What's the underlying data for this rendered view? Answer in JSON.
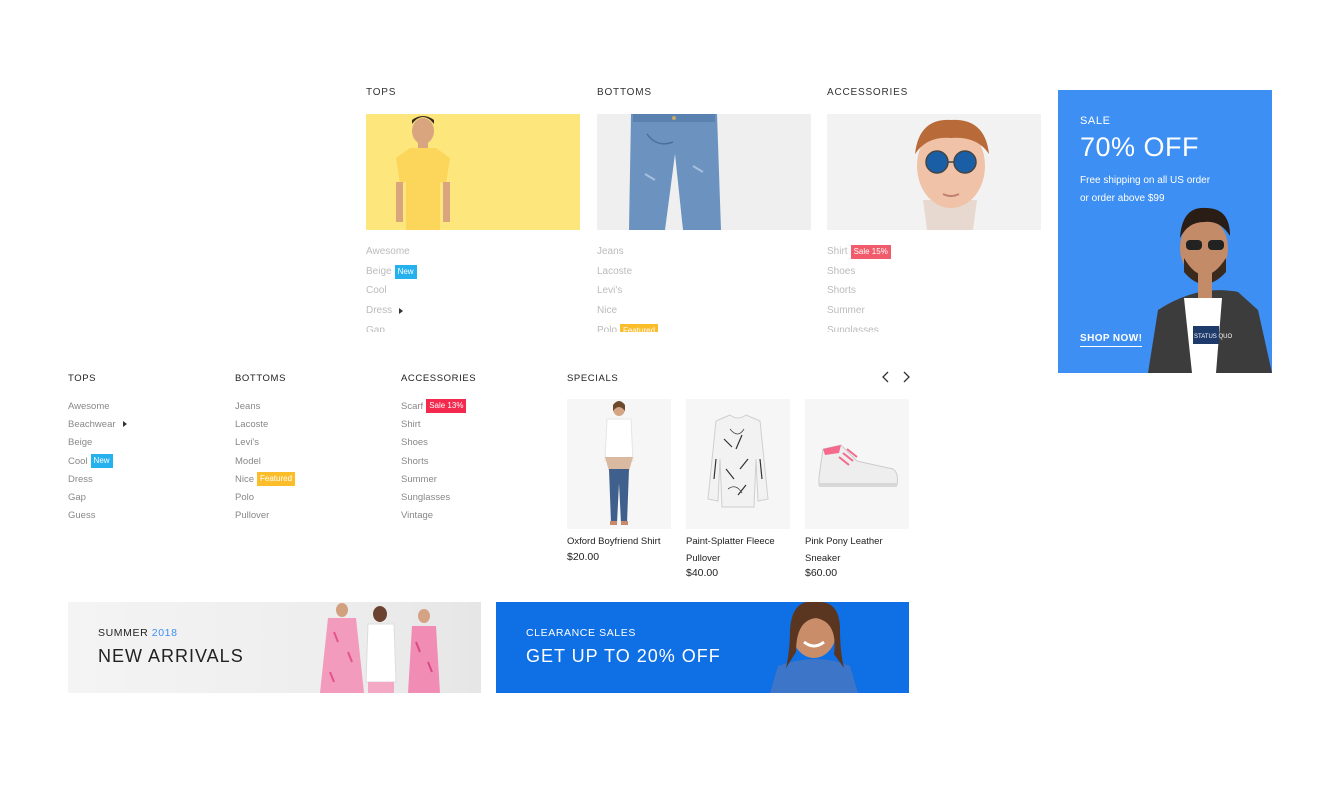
{
  "top_menu": {
    "columns": [
      {
        "title": "TOPS",
        "items": [
          "Awesome",
          "Beige",
          "Cool",
          "Dress",
          "Gap"
        ]
      },
      {
        "title": "BOTTOMS",
        "items": [
          "Jeans",
          "Lacoste",
          "Levi's",
          "Nice",
          "Polo"
        ]
      },
      {
        "title": "ACCESSORIES",
        "items": [
          "Shirt",
          "Shoes",
          "Shorts",
          "Summer",
          "Sunglasses"
        ]
      }
    ],
    "badges": {
      "beige": "New",
      "polo": "Featured",
      "shirt": "Sale 15%"
    }
  },
  "sale_panel": {
    "label": "SALE",
    "headline": "70% OFF",
    "line1": "Free shipping on all US order",
    "line2": "or order above $99",
    "cta": "SHOP NOW!",
    "tee_text": "STATUS QUO",
    "bg_color": "#3d8ff3"
  },
  "second_menu": {
    "columns": [
      {
        "title": "TOPS",
        "items": [
          "Awesome",
          "Beachwear",
          "Beige",
          "Cool",
          "Dress",
          "Gap",
          "Guess"
        ]
      },
      {
        "title": "BOTTOMS",
        "items": [
          "Jeans",
          "Lacoste",
          "Levi's",
          "Model",
          "Nice",
          "Polo",
          "Pullover"
        ]
      },
      {
        "title": "ACCESSORIES",
        "items": [
          "Scarf",
          "Shirt",
          "Shoes",
          "Shorts",
          "Summer",
          "Sunglasses",
          "Vintage"
        ]
      }
    ],
    "badges": {
      "cool": "New",
      "nice": "Featured",
      "scarf": "Sale 13%"
    },
    "specials": {
      "title": "SPECIALS",
      "products": [
        {
          "name": "Oxford Boyfriend Shirt",
          "price": "$20.00"
        },
        {
          "name": "Paint-Splatter Fleece Pullover",
          "price": "$40.00"
        },
        {
          "name": "Pink Pony Leather Sneaker",
          "price": "$60.00"
        }
      ]
    }
  },
  "banners": {
    "summer": {
      "small_prefix": "SUMMER",
      "year": "2018",
      "headline": "NEW ARRIVALS"
    },
    "clearance": {
      "small": "CLEARANCE SALES",
      "headline": "GET UP TO 20% OFF",
      "bg_color": "#0f6fe4"
    }
  },
  "colors": {
    "new_badge": "#25b0ee",
    "featured_badge": "#fbbd2a",
    "sale_badge": "#f3294e"
  }
}
